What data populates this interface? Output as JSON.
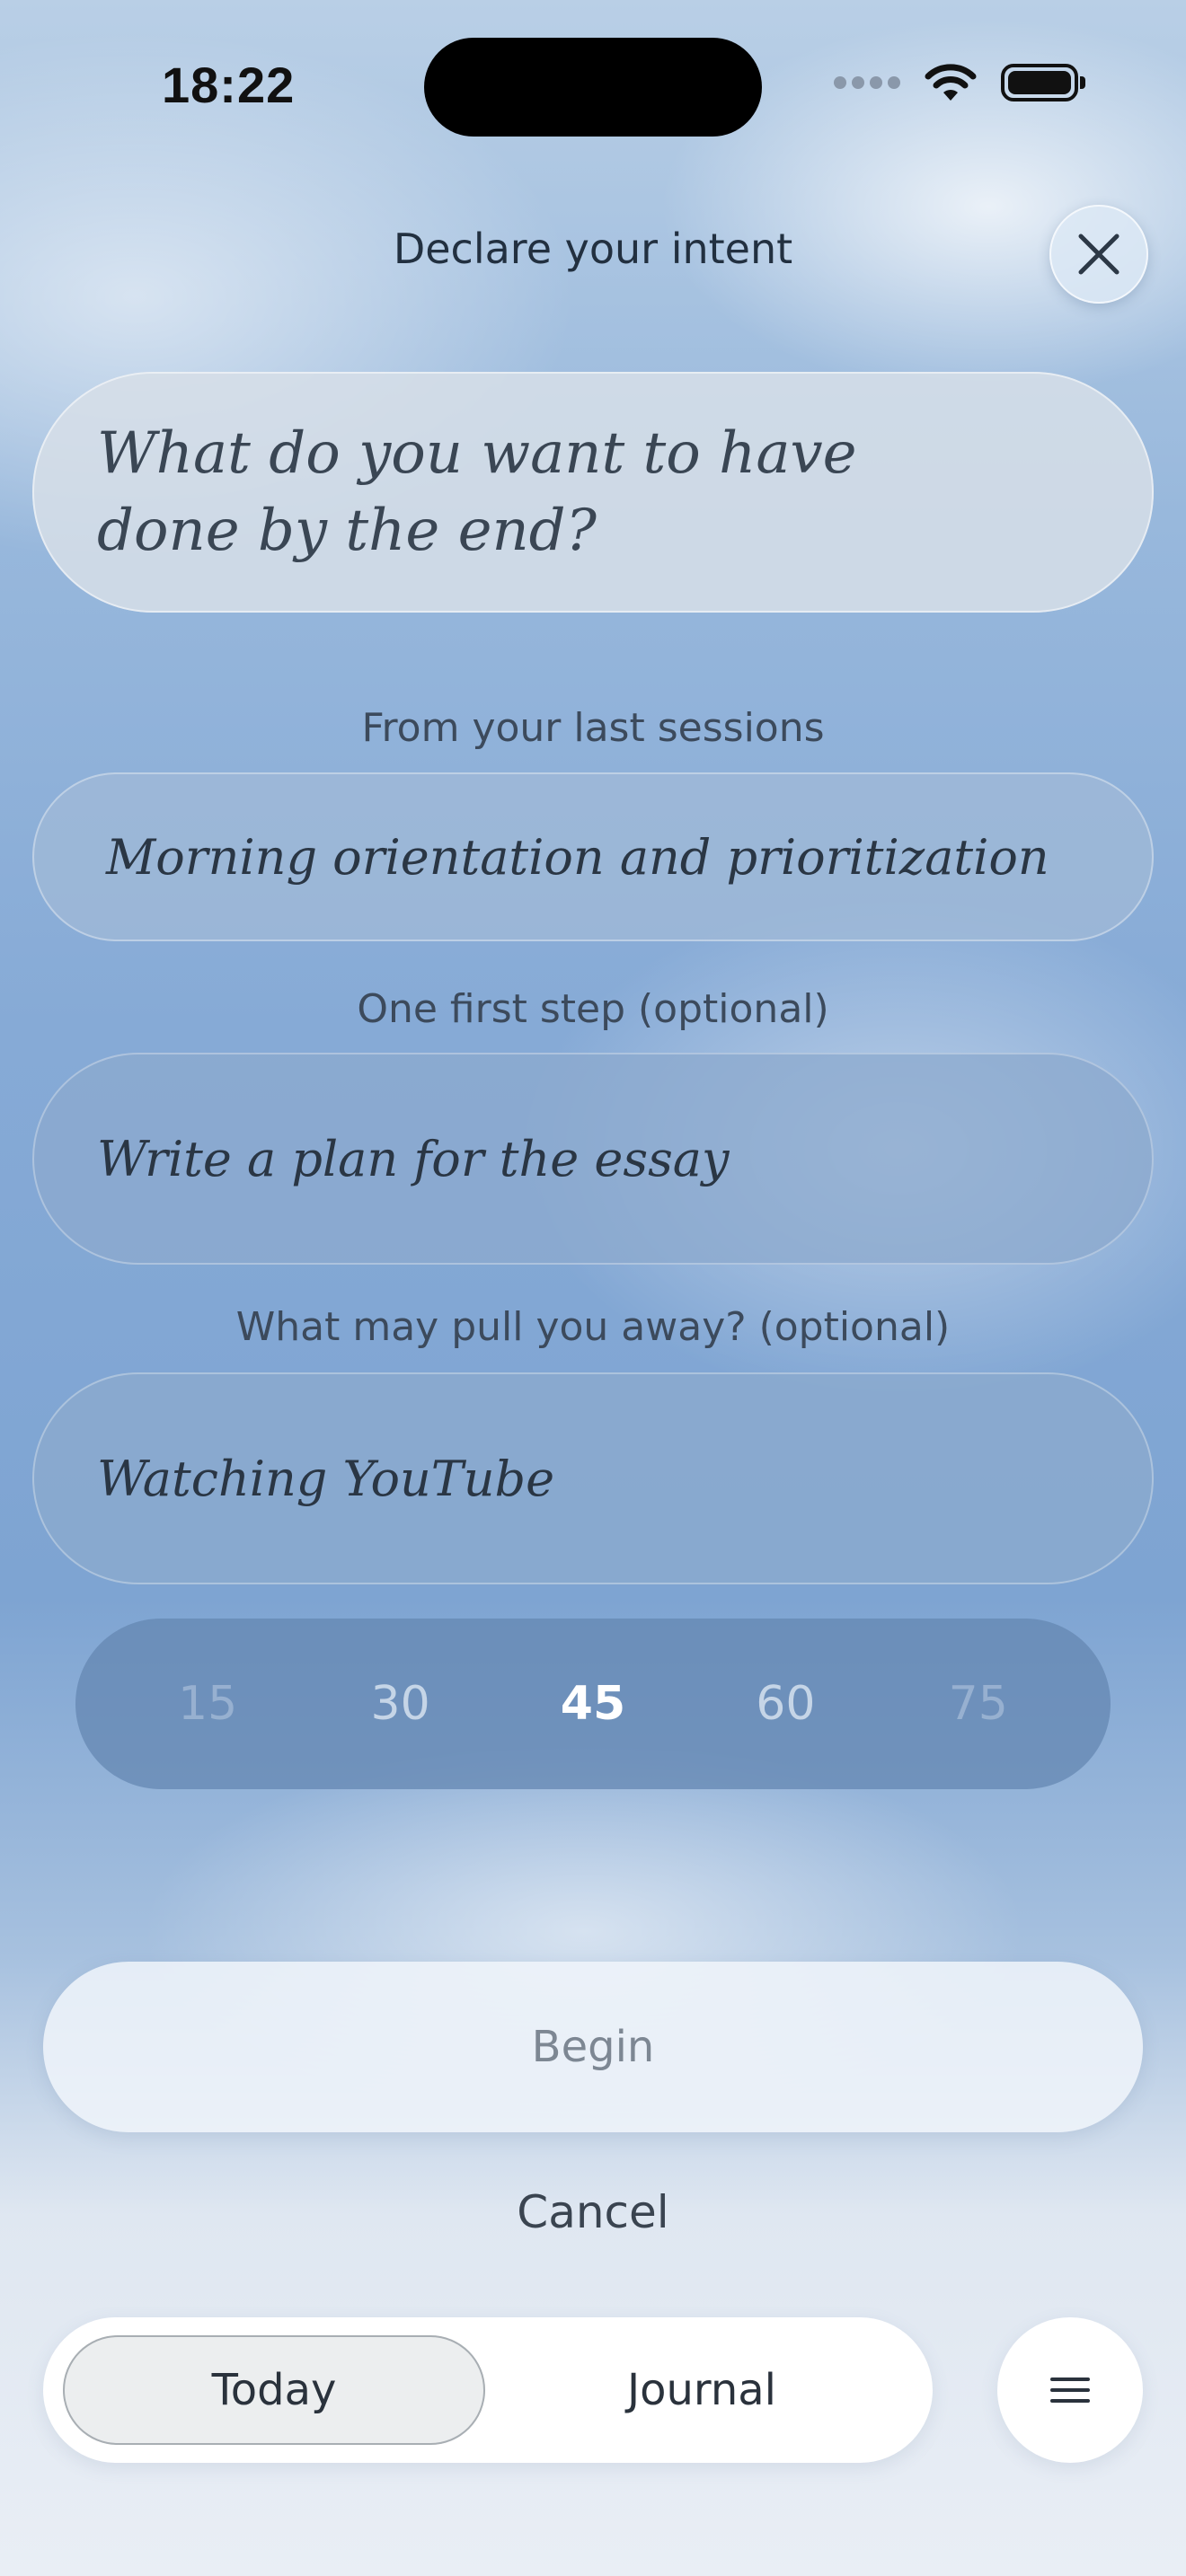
{
  "status_bar": {
    "time": "18:22"
  },
  "header": {
    "title": "Declare your intent"
  },
  "intent": {
    "placeholder": "What do you want to have done by the end?"
  },
  "last_sessions": {
    "label": "From your last sessions",
    "value": "Morning orientation and prioritization"
  },
  "first_step": {
    "label": "One first step (optional)",
    "value": "Write a plan for the essay"
  },
  "distraction": {
    "label": "What may pull you away? (optional)",
    "value": "Watching YouTube"
  },
  "duration_picker": {
    "options": [
      "15",
      "30",
      "45",
      "60",
      "75"
    ],
    "selected": "45"
  },
  "actions": {
    "begin": "Begin",
    "cancel": "Cancel"
  },
  "tabbar": {
    "tabs": [
      "Today",
      "Journal"
    ],
    "active": "Today"
  },
  "icons": {
    "close": "close-icon",
    "menu": "menu-icon",
    "wifi": "wifi-icon",
    "battery": "battery-icon"
  }
}
